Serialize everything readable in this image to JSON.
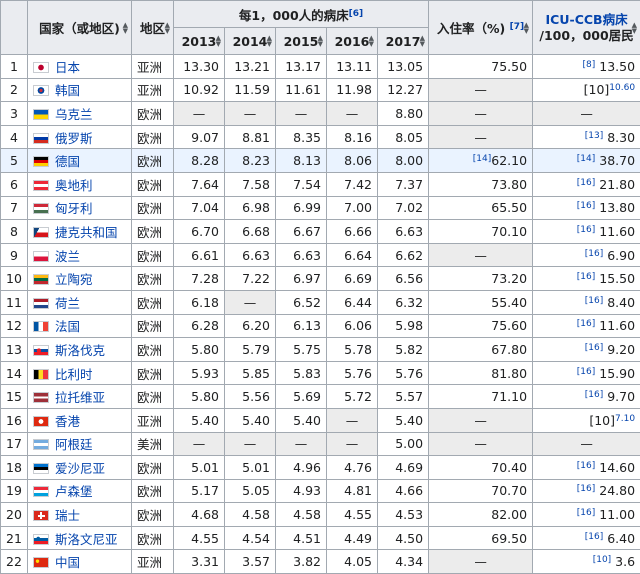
{
  "header": {
    "country": "国家（或地区)",
    "region": "地区",
    "beds_per_1000": "每1，000人的病床",
    "beds_ref": "[6]",
    "years": [
      "2013",
      "2014",
      "2015",
      "2016",
      "2017"
    ],
    "occupancy": "入住率（%)",
    "occupancy_ref": "[7]",
    "icu_line1": "ICU-CCB病床",
    "icu_line2": "/100，000居民"
  },
  "rows": [
    {
      "rank": "1",
      "country": "日本",
      "flag": "jp",
      "region": "亚洲",
      "v": [
        "13.30",
        "13.21",
        "13.17",
        "13.11",
        "13.05"
      ],
      "occ": "75.50",
      "occ_ref": "",
      "icu_ref": "[8]",
      "icu": "13.50"
    },
    {
      "rank": "2",
      "country": "韩国",
      "flag": "kr",
      "region": "亚洲",
      "v": [
        "10.92",
        "11.59",
        "11.61",
        "11.98",
        "12.27"
      ],
      "occ": "—",
      "occ_ref": "",
      "icu_ref": "[10]",
      "icu": "10.60",
      "icu_prefix": "[10]"
    },
    {
      "rank": "3",
      "country": "乌克兰",
      "flag": "ua",
      "region": "欧洲",
      "v": [
        "—",
        "—",
        "—",
        "—",
        "8.80"
      ],
      "occ": "—",
      "occ_ref": "",
      "icu_ref": "",
      "icu": "—"
    },
    {
      "rank": "4",
      "country": "俄罗斯",
      "flag": "ru",
      "region": "欧洲",
      "v": [
        "9.07",
        "8.81",
        "8.35",
        "8.16",
        "8.05"
      ],
      "occ": "—",
      "occ_ref": "",
      "icu_ref": "[13]",
      "icu": "8.30"
    },
    {
      "rank": "5",
      "country": "德国",
      "flag": "de",
      "region": "欧洲",
      "v": [
        "8.28",
        "8.23",
        "8.13",
        "8.06",
        "8.00"
      ],
      "occ": "62.10",
      "occ_ref": "[14]",
      "icu_ref": "[14]",
      "icu": "38.70"
    },
    {
      "rank": "6",
      "country": "奥地利",
      "flag": "at",
      "region": "欧洲",
      "v": [
        "7.64",
        "7.58",
        "7.54",
        "7.42",
        "7.37"
      ],
      "occ": "73.80",
      "occ_ref": "",
      "icu_ref": "[16]",
      "icu": "21.80"
    },
    {
      "rank": "7",
      "country": "匈牙利",
      "flag": "hu",
      "region": "欧洲",
      "v": [
        "7.04",
        "6.98",
        "6.99",
        "7.00",
        "7.02"
      ],
      "occ": "65.50",
      "occ_ref": "",
      "icu_ref": "[16]",
      "icu": "13.80"
    },
    {
      "rank": "8",
      "country": "捷克共和国",
      "flag": "cz",
      "region": "欧洲",
      "v": [
        "6.70",
        "6.68",
        "6.67",
        "6.66",
        "6.63"
      ],
      "occ": "70.10",
      "occ_ref": "",
      "icu_ref": "[16]",
      "icu": "11.60"
    },
    {
      "rank": "9",
      "country": "波兰",
      "flag": "pl",
      "region": "欧洲",
      "v": [
        "6.61",
        "6.63",
        "6.63",
        "6.64",
        "6.62"
      ],
      "occ": "—",
      "occ_ref": "",
      "icu_ref": "[16]",
      "icu": "6.90"
    },
    {
      "rank": "10",
      "country": "立陶宛",
      "flag": "lt",
      "region": "欧洲",
      "v": [
        "7.28",
        "7.22",
        "6.97",
        "6.69",
        "6.56"
      ],
      "occ": "73.20",
      "occ_ref": "",
      "icu_ref": "[16]",
      "icu": "15.50"
    },
    {
      "rank": "11",
      "country": "荷兰",
      "flag": "nl",
      "region": "欧洲",
      "v": [
        "6.18",
        "—",
        "6.52",
        "6.44",
        "6.32"
      ],
      "occ": "55.40",
      "occ_ref": "",
      "icu_ref": "[16]",
      "icu": "8.40"
    },
    {
      "rank": "12",
      "country": "法国",
      "flag": "fr",
      "region": "欧洲",
      "v": [
        "6.28",
        "6.20",
        "6.13",
        "6.06",
        "5.98"
      ],
      "occ": "75.60",
      "occ_ref": "",
      "icu_ref": "[16]",
      "icu": "11.60"
    },
    {
      "rank": "13",
      "country": "斯洛伐克",
      "flag": "sk",
      "region": "欧洲",
      "v": [
        "5.80",
        "5.79",
        "5.75",
        "5.78",
        "5.82"
      ],
      "occ": "67.80",
      "occ_ref": "",
      "icu_ref": "[16]",
      "icu": "9.20"
    },
    {
      "rank": "14",
      "country": "比利时",
      "flag": "be",
      "region": "欧洲",
      "v": [
        "5.93",
        "5.85",
        "5.83",
        "5.76",
        "5.76"
      ],
      "occ": "81.80",
      "occ_ref": "",
      "icu_ref": "[16]",
      "icu": "15.90"
    },
    {
      "rank": "15",
      "country": "拉托维亚",
      "flag": "lv",
      "region": "欧洲",
      "v": [
        "5.80",
        "5.56",
        "5.69",
        "5.72",
        "5.57"
      ],
      "occ": "71.10",
      "occ_ref": "",
      "icu_ref": "[16]",
      "icu": "9.70"
    },
    {
      "rank": "16",
      "country": "香港",
      "flag": "hk",
      "region": "亚洲",
      "v": [
        "5.40",
        "5.40",
        "5.40",
        "—",
        "5.40"
      ],
      "occ": "—",
      "occ_ref": "",
      "icu_ref": "[10]",
      "icu": "7.10",
      "icu_prefix": "[10]"
    },
    {
      "rank": "17",
      "country": "阿根廷",
      "flag": "ar",
      "region": "美洲",
      "v": [
        "—",
        "—",
        "—",
        "—",
        "5.00"
      ],
      "occ": "—",
      "occ_ref": "",
      "icu_ref": "",
      "icu": "—"
    },
    {
      "rank": "18",
      "country": "爱沙尼亚",
      "flag": "ee",
      "region": "欧洲",
      "v": [
        "5.01",
        "5.01",
        "4.96",
        "4.76",
        "4.69"
      ],
      "occ": "70.40",
      "occ_ref": "",
      "icu_ref": "[16]",
      "icu": "14.60"
    },
    {
      "rank": "19",
      "country": "卢森堡",
      "flag": "lu",
      "region": "欧洲",
      "v": [
        "5.17",
        "5.05",
        "4.93",
        "4.81",
        "4.66"
      ],
      "occ": "70.70",
      "occ_ref": "",
      "icu_ref": "[16]",
      "icu": "24.80"
    },
    {
      "rank": "20",
      "country": "瑞士",
      "flag": "ch",
      "region": "欧洲",
      "v": [
        "4.68",
        "4.58",
        "4.58",
        "4.55",
        "4.53"
      ],
      "occ": "82.00",
      "occ_ref": "",
      "icu_ref": "[16]",
      "icu": "11.00"
    },
    {
      "rank": "21",
      "country": "斯洛文尼亚",
      "flag": "si",
      "region": "欧洲",
      "v": [
        "4.55",
        "4.54",
        "4.51",
        "4.49",
        "4.50"
      ],
      "occ": "69.50",
      "occ_ref": "",
      "icu_ref": "[16]",
      "icu": "6.40"
    },
    {
      "rank": "22",
      "country": "中国",
      "flag": "cn",
      "region": "亚洲",
      "v": [
        "3.31",
        "3.57",
        "3.82",
        "4.05",
        "4.34"
      ],
      "occ": "—",
      "occ_ref": "",
      "icu_ref": "[10]",
      "icu": "3.6"
    }
  ],
  "colors": {
    "header_bg": "#eaecf0",
    "border": "#a2a9b1",
    "link": "#0645ad",
    "highlight_row": "#eaf3ff",
    "na_cell": "#ececec"
  }
}
